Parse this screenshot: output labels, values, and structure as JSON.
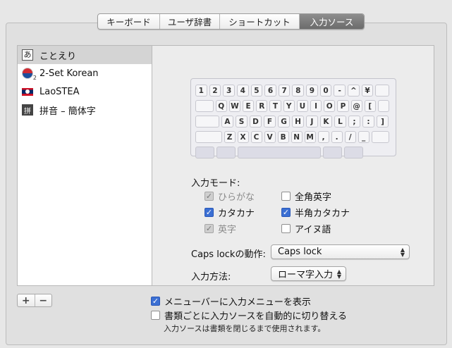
{
  "tabs": [
    {
      "label": "キーボード"
    },
    {
      "label": "ユーザ辞書"
    },
    {
      "label": "ショートカット"
    },
    {
      "label": "入力ソース"
    }
  ],
  "input_sources": [
    {
      "label": "ことえり",
      "icon": "kotoeri-icon",
      "icon_text": "あ"
    },
    {
      "label": "2-Set Korean",
      "icon": "korean-flag-icon"
    },
    {
      "label": "LaoSTEA",
      "icon": "lao-flag-icon"
    },
    {
      "label": "拼音 – 簡体字",
      "icon": "pinyin-icon",
      "icon_text": "拼"
    }
  ],
  "keyboard": {
    "row1": [
      "1",
      "2",
      "3",
      "4",
      "5",
      "6",
      "7",
      "8",
      "9",
      "0",
      "-",
      "^",
      "¥"
    ],
    "row2": [
      "Q",
      "W",
      "E",
      "R",
      "T",
      "Y",
      "U",
      "I",
      "O",
      "P",
      "@",
      "["
    ],
    "row3": [
      "A",
      "S",
      "D",
      "F",
      "G",
      "H",
      "J",
      "K",
      "L",
      ";",
      ":",
      "]"
    ],
    "row4": [
      "Z",
      "X",
      "C",
      "V",
      "B",
      "N",
      "M",
      ",",
      ".",
      "/",
      "_"
    ]
  },
  "input_mode": {
    "label": "入力モード:",
    "options": [
      {
        "label": "ひらがな",
        "checked": true,
        "disabled": true
      },
      {
        "label": "全角英字",
        "checked": false,
        "disabled": false
      },
      {
        "label": "カタカナ",
        "checked": true,
        "disabled": false
      },
      {
        "label": "半角カタカナ",
        "checked": true,
        "disabled": false
      },
      {
        "label": "英字",
        "checked": true,
        "disabled": true
      },
      {
        "label": "アイヌ語",
        "checked": false,
        "disabled": false
      }
    ]
  },
  "caps_lock": {
    "label": "Caps lockの動作:",
    "value": "Caps lock"
  },
  "input_method": {
    "label": "入力方法:",
    "value": "ローマ字入力"
  },
  "bottom": {
    "add": "+",
    "remove": "−",
    "show_menu": {
      "label": "メニューバーに入力メニューを表示",
      "checked": true
    },
    "auto_switch": {
      "label": "書類ごとに入力ソースを自動的に切り替える",
      "checked": false
    },
    "note": "入力ソースは書類を閉じるまで使用されます。"
  },
  "colors": {
    "accent": "#3b6fd3",
    "tab_active": "#7a7a7a"
  }
}
